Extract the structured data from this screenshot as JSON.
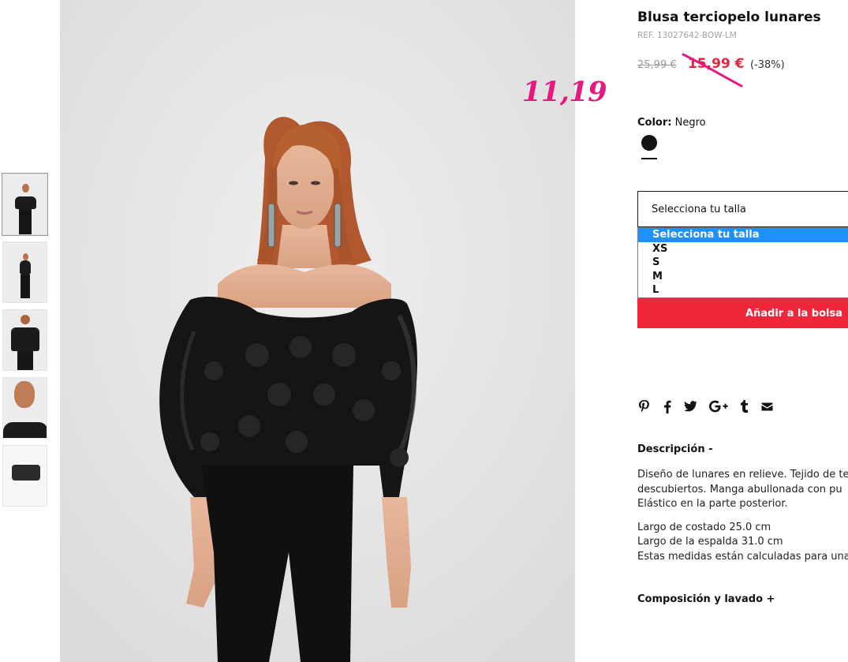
{
  "product": {
    "title": "Blusa terciopelo lunares",
    "ref": "REF. 13027642-BOW-LM",
    "old_price": "25,99 €",
    "sale_price": "15,99 €",
    "discount": "(-38%)",
    "handwritten_price": "11,19",
    "handwritten_color": "#e8197e",
    "sale_color": "#e0263a"
  },
  "color": {
    "label": "Color:",
    "value": "Negro",
    "swatch": "#141414"
  },
  "size": {
    "placeholder": "Selecciona tu talla",
    "options": [
      "Selecciona tu talla",
      "XS",
      "S",
      "M",
      "L"
    ],
    "highlighted": "Selecciona tu talla",
    "highlight_color": "#1e90ff"
  },
  "add_button": {
    "label": "Añadir a la bolsa",
    "color": "#f0273a"
  },
  "share_icons": [
    "pinterest-icon",
    "facebook-icon",
    "twitter-icon",
    "google-plus-icon",
    "tumblr-icon",
    "mail-icon"
  ],
  "description": {
    "title": "Descripción -",
    "lines": [
      "Diseño de lunares en relieve. Tejido de te",
      "descubiertos. Manga abullonada con pu",
      "Elástico en la parte posterior."
    ],
    "measures": [
      "Largo de costado 25.0 cm",
      "Largo de la espalda 31.0 cm",
      "Estas medidas están calculadas para una"
    ]
  },
  "composition": {
    "title": "Composición y lavado +"
  },
  "gallery": {
    "thumbnails": [
      "thumbnail-front",
      "thumbnail-full-body",
      "thumbnail-back",
      "thumbnail-detail",
      "thumbnail-flat"
    ]
  }
}
